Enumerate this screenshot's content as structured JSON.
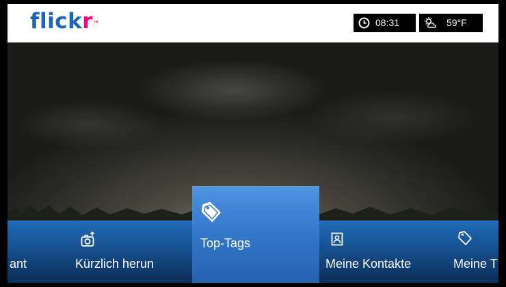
{
  "header": {
    "logo_main": "flick",
    "logo_accent": "r",
    "logo_tm": "™",
    "clock": {
      "icon": "clock-icon",
      "time": "08:31"
    },
    "weather": {
      "icon": "partly-sunny-icon",
      "temperature": "59°F"
    }
  },
  "menu": {
    "items": [
      {
        "label": "ant",
        "icon": null
      },
      {
        "label": "Kürzlich herun",
        "icon": "camera-upload-icon"
      },
      {
        "label": "Top-Tags",
        "icon": "tag-icon",
        "selected": true
      },
      {
        "label": "Meine Kontakte",
        "icon": "contact-card-icon"
      },
      {
        "label": "Meine T",
        "icon": "tag-icon"
      }
    ]
  },
  "colors": {
    "logo_blue": "#1e64b8",
    "logo_pink": "#ff0084",
    "menu_bar": "#16508f",
    "selected": "#3277c9"
  }
}
